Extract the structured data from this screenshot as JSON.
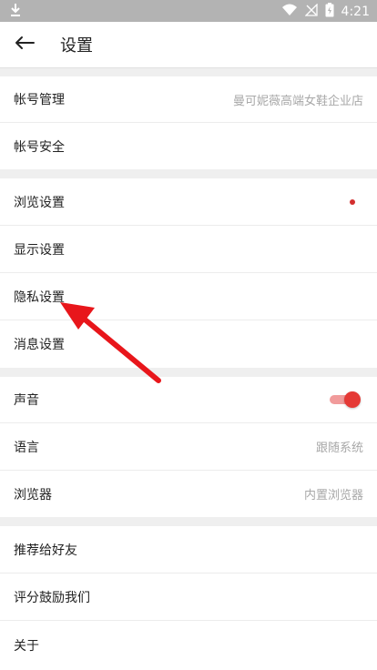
{
  "status_bar": {
    "time": "4:21",
    "download_icon": "download-icon",
    "wifi_icon": "wifi-icon",
    "signal_icon": "no-signal-icon",
    "battery_icon": "battery-charging-icon"
  },
  "header": {
    "back_icon": "arrow-left-icon",
    "title": "设置"
  },
  "sections": {
    "account": {
      "manage_label": "帐号管理",
      "manage_value": "曼可妮薇高端女鞋企业店",
      "security_label": "帐号安全"
    },
    "settings": {
      "browse_label": "浏览设置",
      "display_label": "显示设置",
      "privacy_label": "隐私设置",
      "message_label": "消息设置"
    },
    "prefs": {
      "sound_label": "声音",
      "sound_on": true,
      "language_label": "语言",
      "language_value": "跟随系统",
      "browser_label": "浏览器",
      "browser_value": "内置浏览器"
    },
    "misc": {
      "recommend_label": "推荐给好友",
      "rate_label": "评分鼓励我们",
      "about_label": "关于"
    }
  },
  "colors": {
    "accent": "#e53935",
    "annotation_arrow": "#e8161b"
  }
}
